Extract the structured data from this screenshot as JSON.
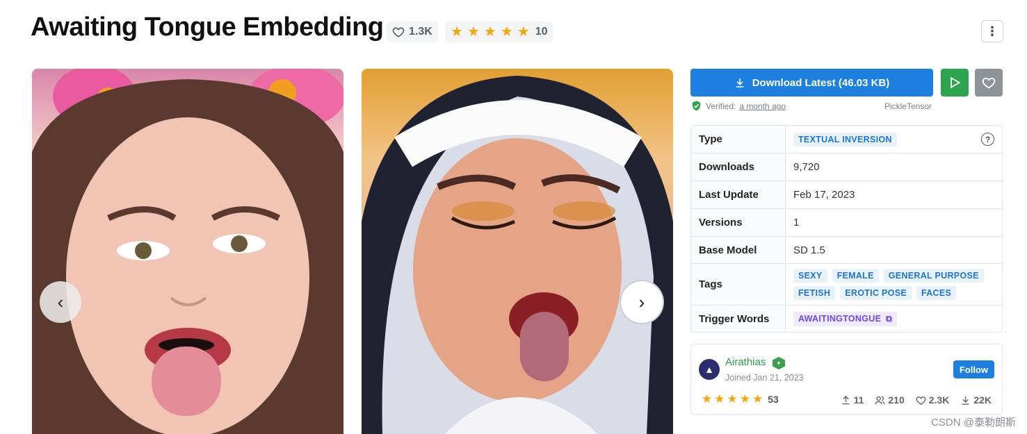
{
  "page": {
    "title": "Awaiting Tongue Embedding",
    "likes": "1.3K",
    "rating_count": "10",
    "more_icon": "dots-vertical-icon"
  },
  "gallery": {
    "images": [
      {
        "name": "gallery-image-1"
      },
      {
        "name": "gallery-image-2"
      }
    ],
    "prev_icon": "chevron-left-icon",
    "next_icon": "chevron-right-icon"
  },
  "actions": {
    "download_label": "Download Latest (46.03 KB)",
    "verified_label": "Verified:",
    "verified_when": "a month ago",
    "scanner": "PickleTensor"
  },
  "details": {
    "rows": [
      {
        "label": "Type",
        "value": "TEXTUAL INVERSION"
      },
      {
        "label": "Downloads",
        "value": "9,720"
      },
      {
        "label": "Last Update",
        "value": "Feb 17, 2023"
      },
      {
        "label": "Versions",
        "value": "1"
      },
      {
        "label": "Base Model",
        "value": "SD 1.5"
      },
      {
        "label": "Tags",
        "tags": [
          "SEXY",
          "FEMALE",
          "GENERAL PURPOSE",
          "FETISH",
          "EROTIC POSE",
          "FACES"
        ]
      },
      {
        "label": "Trigger Words",
        "value": "AWAITINGTONGUE"
      }
    ]
  },
  "creator": {
    "name": "Airathias",
    "joined": "Joined Jan 21, 2023",
    "follow_label": "Follow",
    "rating_count": "53",
    "stats": {
      "uploads": "11",
      "followers": "210",
      "likes": "2.3K",
      "downloads": "22K"
    }
  },
  "watermark": "CSDN @泰勒朗斯",
  "colors": {
    "primary": "#1d7fe0",
    "success": "#2da44e",
    "star": "#f5a60b",
    "badge_blue": "#1c74d3",
    "badge_purple": "#7048e8"
  }
}
